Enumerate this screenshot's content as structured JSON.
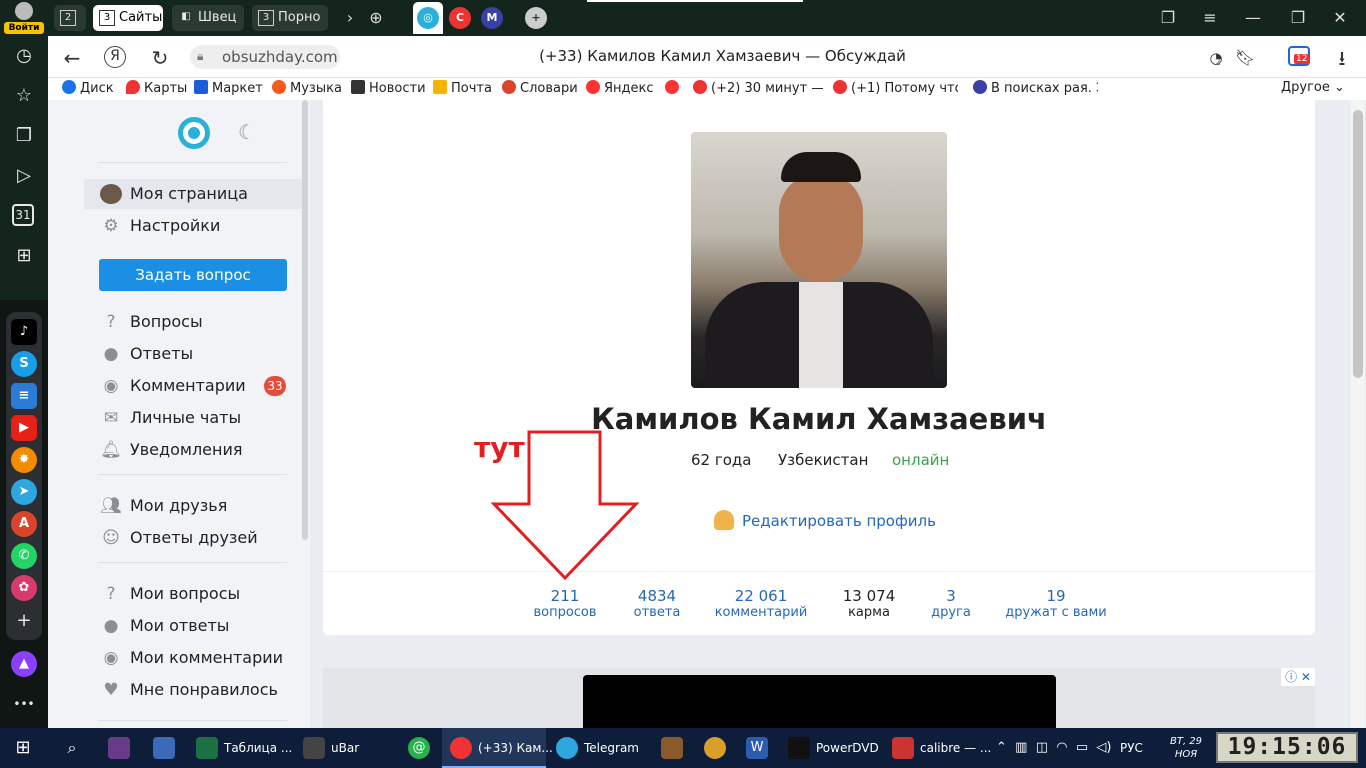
{
  "left_rail": {
    "login_label": "Войти",
    "icons": [
      "history-icon",
      "bookmarks-star-icon",
      "collections-icon",
      "video-icon",
      "calendar-icon",
      "apps-grid-icon"
    ],
    "calendar_day": "31",
    "apps": [
      "tiktok",
      "skype",
      "tasks",
      "youtube",
      "star-app",
      "telegram",
      "translate",
      "whatsapp",
      "flower-app"
    ],
    "add_label": "+",
    "more_label": "•••"
  },
  "tabs": {
    "groups": [
      {
        "count": "2",
        "label": ""
      },
      {
        "count": "3",
        "label": "Сайты"
      },
      {
        "count": "",
        "label": "Швец"
      },
      {
        "count": "3",
        "label": "Порно"
      }
    ],
    "new_tab_label": "+"
  },
  "address": {
    "url": "obsuzhday.com",
    "page_title": "(+33) Камилов Камил Хамзаевич — Обсуждай",
    "yandex_letter": "Я",
    "downloads_badge": "12",
    "ext_badge": "2"
  },
  "bookmarks": {
    "items": [
      "Диск",
      "Карты",
      "Маркет",
      "Музыка",
      "Новости",
      "Почта",
      "Словари",
      "Яндекс",
      "",
      "(+2) 30 минут — С",
      "(+1) Потому что т",
      "В поисках рая. Эк"
    ],
    "other_label": "Другое"
  },
  "sidebar": {
    "active_item": "Моя страница",
    "settings": "Настройки",
    "ask_button": "Задать вопрос",
    "main_items": [
      "Вопросы",
      "Ответы",
      "Комментарии",
      "Личные чаты",
      "Уведомления"
    ],
    "comments_badge": "33",
    "friends_items": [
      "Мои друзья",
      "Ответы друзей"
    ],
    "my_items": [
      "Мои вопросы",
      "Мои ответы",
      "Мои комментарии",
      "Мне понравилось"
    ]
  },
  "profile": {
    "name": "Камилов Камил Хамзаевич",
    "age": "62 года",
    "country": "Узбекистан",
    "status": "онлайн",
    "edit_link": "Редактировать профиль",
    "stats": [
      {
        "value": "211",
        "label": "вопросов"
      },
      {
        "value": "4834",
        "label": "ответа"
      },
      {
        "value": "22 061",
        "label": "комментарий"
      },
      {
        "value": "13 074",
        "label": "карма"
      },
      {
        "value": "3",
        "label": "друга"
      },
      {
        "value": "19",
        "label": "дружат с вами"
      }
    ]
  },
  "annotation": {
    "text": "тут",
    "color": "#e02020"
  },
  "ad": {
    "info_label": "ⓘ ✕"
  },
  "taskbar": {
    "items": [
      "Таблица ...",
      "uBar",
      "(+33) Кам...",
      "Telegram",
      "PowerDVD",
      "calibre — ..."
    ],
    "language": "РУС",
    "date_line1": "ВТ, 29",
    "date_line2": "НОЯ",
    "clock": "19:15:06"
  },
  "colors": {
    "accent": "#1a8fe3",
    "link": "#2468b8",
    "online": "#3aa34a",
    "badge": "#e84a3a"
  }
}
